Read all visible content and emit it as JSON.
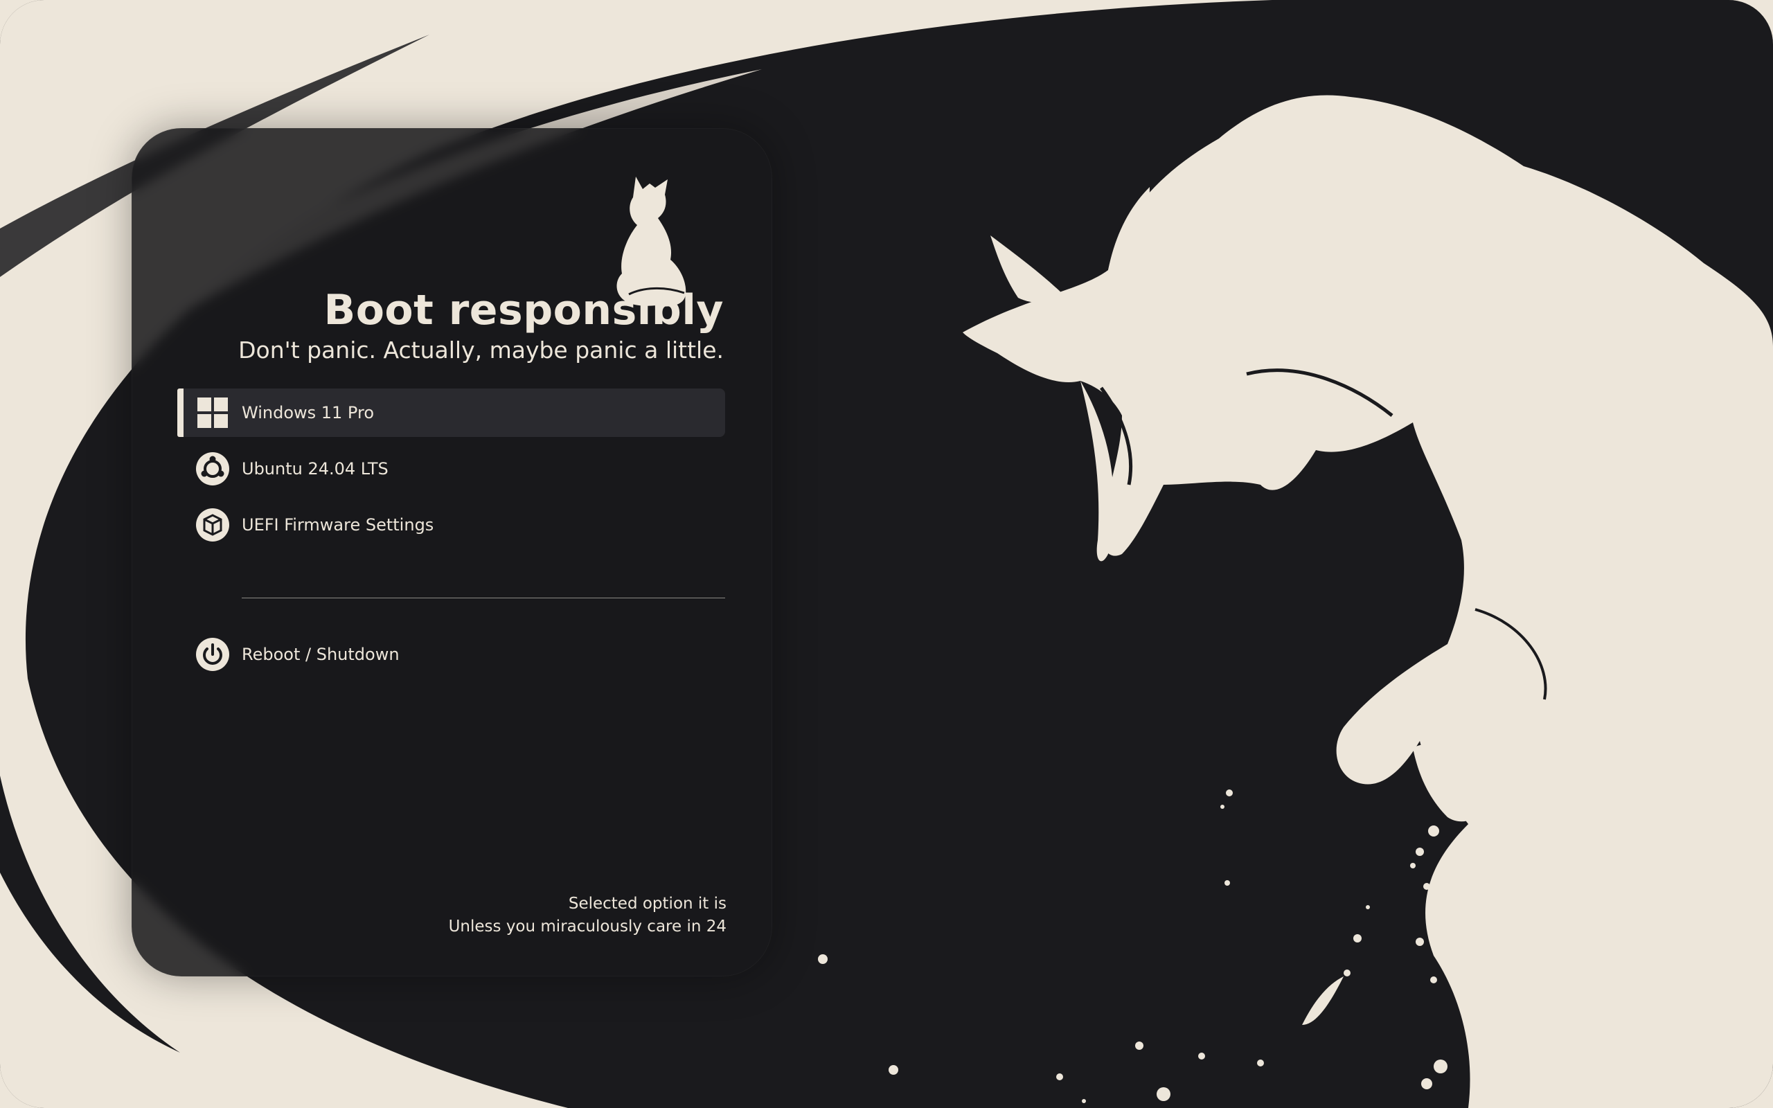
{
  "header": {
    "title": "Boot responsibly",
    "subtitle": "Don't panic. Actually, maybe panic a little."
  },
  "menu": {
    "selected_index": 0,
    "entries": [
      {
        "label": "Windows 11 Pro",
        "icon": "windows-icon"
      },
      {
        "label": "Ubuntu 24.04 LTS",
        "icon": "ubuntu-icon"
      },
      {
        "label": "UEFI Firmware Settings",
        "icon": "uefi-icon"
      }
    ],
    "power": {
      "label": "Reboot / Shutdown",
      "icon": "power-icon"
    }
  },
  "footer": {
    "line1": "Selected option it is",
    "line2": "Unless you miraculously care in 24"
  },
  "colors": {
    "background_dark": "#1a1a1d",
    "cream": "#ede6da",
    "selection": "#2a2a2f"
  }
}
